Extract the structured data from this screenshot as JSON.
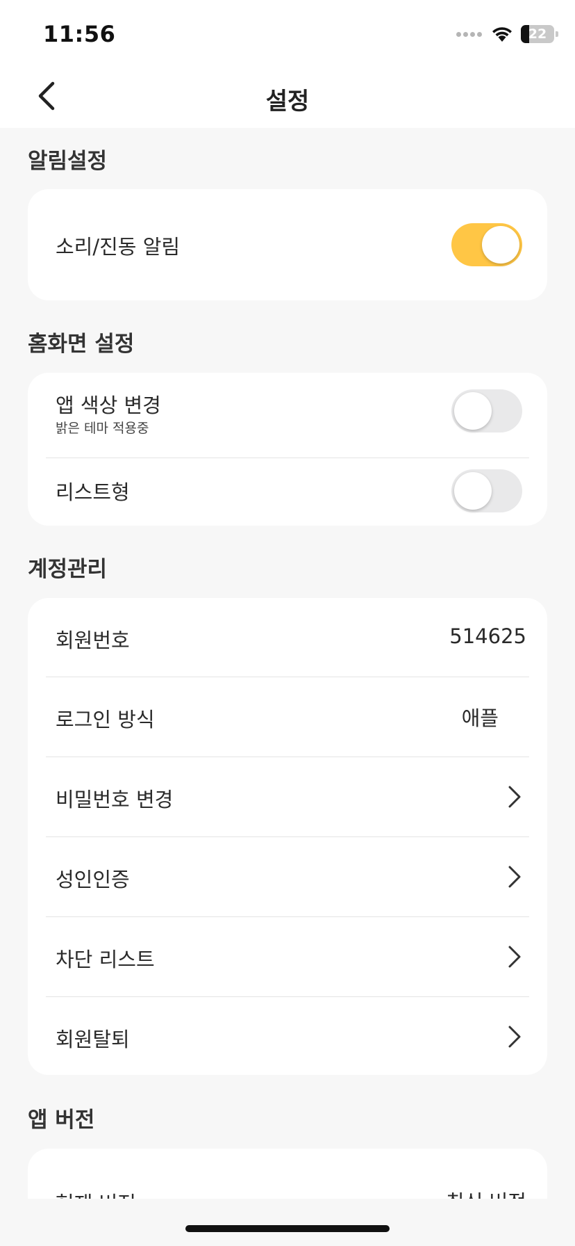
{
  "status_bar": {
    "time": "11:56",
    "battery": "22"
  },
  "nav": {
    "title": "설정"
  },
  "notifications": {
    "title": "알림설정",
    "sound_vibration": {
      "label": "소리/진동 알림",
      "enabled": true
    }
  },
  "home_settings": {
    "title": "홈화면 설정",
    "app_color": {
      "label": "앱 색상 변경",
      "sublabel": "밝은 테마 적용중",
      "enabled": false
    },
    "list_type": {
      "label": "리스트형",
      "enabled": false
    }
  },
  "account": {
    "title": "계정관리",
    "member_number": {
      "label": "회원번호",
      "value": "514625"
    },
    "login_method": {
      "label": "로그인 방식",
      "value": "애플"
    },
    "change_password": {
      "label": "비밀번호 변경"
    },
    "adult_verification": {
      "label": "성인인증"
    },
    "block_list": {
      "label": "차단 리스트"
    },
    "withdrawal": {
      "label": "회원탈퇴"
    }
  },
  "app_version": {
    "title": "앱 버전",
    "current_version": {
      "label": "현재 버전",
      "value": "최신 버전"
    }
  },
  "colors": {
    "toggle_on": "#ffc645",
    "toggle_off": "#e9e9ea",
    "background": "#f7f7f7"
  }
}
